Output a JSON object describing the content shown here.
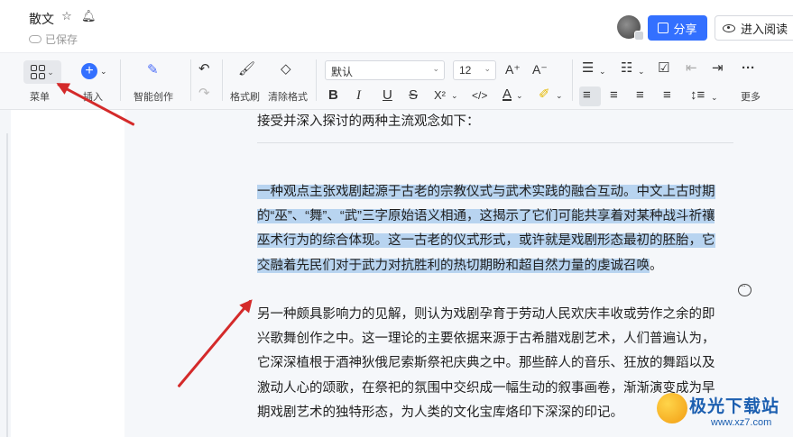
{
  "header": {
    "title": "散文",
    "star_icon": "star-icon",
    "bell_icon": "bell-icon",
    "saved_status": "已保存",
    "share_label": "分享",
    "read_label": "进入阅读"
  },
  "toolbar": {
    "menu_label": "菜单",
    "insert_label": "插入",
    "ai_label": "智能创作",
    "format_painter_label": "格式刷",
    "clear_format_label": "清除格式",
    "font_value": "默认",
    "size_value": "12",
    "more_label": "更多",
    "bold": "B",
    "italic": "I",
    "underline": "U",
    "strike": "S",
    "superscript": "X²",
    "code": "</>",
    "font_color": "A",
    "grow": "A⁺",
    "shrink": "A⁻"
  },
  "document": {
    "intro": "接受并深入探讨的两种主流观念如下：",
    "para1": "一种观点主张戏剧起源于古老的宗教仪式与武术实践的融合互动。中文上古时期的“巫”、“舞”、“武”三字原始语义相通，这揭示了它们可能共享着对某种战斗祈禳巫术行为的综合体现。这一古老的仪式形式，或许就是戏剧形态最初的胚胎，它交融着先民们对于武力对抗胜利的热切期盼和超自然力量的虔诚召唤",
    "para1_tail": "。",
    "para2": "另一种颇具影响力的见解，则认为戏剧孕育于劳动人民欢庆丰收或劳作之余的即兴歌舞创作之中。这一理论的主要依据来源于古希腊戏剧艺术，人们普遍认为，它深深植根于酒神狄俄尼索斯祭祀庆典之中。那些醉人的音乐、狂放的舞蹈以及激动人心的颂歌，在祭祀的氛围中交织成一幅生动的叙事画卷，渐渐演变成为早期戏剧艺术的独特形态，为人类的文化宝库烙印下深深的印记。"
  },
  "watermark": {
    "title": "极光下载站",
    "url": "www.xz7.com"
  },
  "colors": {
    "accent": "#3370ff",
    "highlight": "#b8d4f0",
    "arrow": "#d42a2a"
  }
}
